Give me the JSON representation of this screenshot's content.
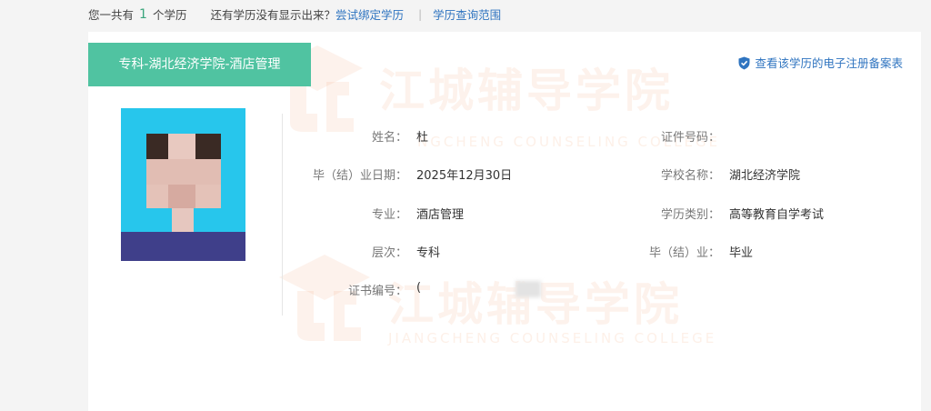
{
  "summary": {
    "prefix": "您一共有",
    "count": "1",
    "suffix": "个学历",
    "question": "还有学历没有显示出来？",
    "bind_link": "尝试绑定学历",
    "divider": "|",
    "scope_link": "学历查询范围"
  },
  "record": {
    "title": "专科-湖北经济学院-酒店管理",
    "register_link": "查看该学历的电子注册备案表",
    "fields": {
      "name_label": "姓名：",
      "name_value": "杜",
      "id_label": "证件号码：",
      "id_value": "",
      "grad_date_label": "毕（结）业日期：",
      "grad_date_value": "2025年12月30日",
      "school_label": "学校名称：",
      "school_value": "湖北经济学院",
      "major_label": "专业：",
      "major_value": "酒店管理",
      "type_label": "学历类别：",
      "type_value": "高等教育自学考试",
      "level_label": "层次：",
      "level_value": "专科",
      "status_label": "毕（结）业：",
      "status_value": "毕业",
      "cert_label": "证书编号：",
      "cert_value": "("
    }
  },
  "watermark": {
    "cn": "江城辅导学院",
    "en_top": "NGCHENG COUNSELING COLLEGE",
    "en_bottom": "JIANGCHENG COUNSELING COLLEGE"
  },
  "colors": {
    "title_bg": "#50c3a1",
    "link": "#2f74c0",
    "photo_bg": "#27c6ec",
    "count": "#3aa57c"
  }
}
